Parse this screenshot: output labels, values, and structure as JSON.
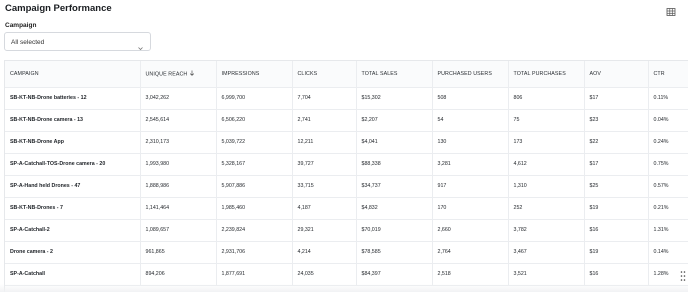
{
  "page": {
    "title": "Campaign Performance"
  },
  "toolbar": {
    "table_icon": "table-layout-icon"
  },
  "filter": {
    "label": "Campaign",
    "selected": "All selected",
    "icon": "chevron-down-icon"
  },
  "table": {
    "columns": [
      {
        "label": "CAMPAIGN"
      },
      {
        "label": "UNIQUE REACH",
        "sorted": "desc"
      },
      {
        "label": "IMPRESSIONS"
      },
      {
        "label": "CLICKS"
      },
      {
        "label": "TOTAL SALES"
      },
      {
        "label": "PURCHASED USERS"
      },
      {
        "label": "TOTAL PURCHASES"
      },
      {
        "label": "AOV"
      },
      {
        "label": "CTR"
      }
    ],
    "rows": [
      [
        "SB-KT-NB-Drone batteries - 12",
        "3,042,262",
        "6,999,700",
        "7,704",
        "$15,302",
        "508",
        "806",
        "$17",
        "0.11%"
      ],
      [
        "SB-KT-NB-Drone camera - 13",
        "2,545,614",
        "6,506,220",
        "2,741",
        "$2,207",
        "54",
        "75",
        "$23",
        "0.04%"
      ],
      [
        "SB-KT-NB-Drone App",
        "2,310,173",
        "5,039,722",
        "12,211",
        "$4,041",
        "130",
        "173",
        "$22",
        "0.24%"
      ],
      [
        "SP-A-Catchall-TOS-Drone camera - 20",
        "1,993,980",
        "5,328,167",
        "39,727",
        "$88,338",
        "3,281",
        "4,612",
        "$17",
        "0.75%"
      ],
      [
        "SP-A-Hand held Drones - 47",
        "1,888,986",
        "5,907,886",
        "33,715",
        "$34,737",
        "917",
        "1,310",
        "$25",
        "0.57%"
      ],
      [
        "SB-KT-NB-Drones - 7",
        "1,141,464",
        "1,985,460",
        "4,187",
        "$4,832",
        "170",
        "252",
        "$19",
        "0.21%"
      ],
      [
        "SP-A-Catchall-2",
        "1,089,657",
        "2,239,824",
        "29,321",
        "$70,019",
        "2,660",
        "3,782",
        "$16",
        "1.31%"
      ],
      [
        "Drone camera - 2",
        "961,865",
        "2,931,706",
        "4,214",
        "$78,585",
        "2,764",
        "3,467",
        "$19",
        "0.14%"
      ],
      [
        "SP-A-Catchall",
        "894,206",
        "1,877,691",
        "24,035",
        "$84,397",
        "2,518",
        "3,521",
        "$16",
        "1.28%"
      ]
    ]
  },
  "colors": {
    "header_bg": "#fafbfc",
    "border": "#ebedf0",
    "text": "#1f2328"
  }
}
